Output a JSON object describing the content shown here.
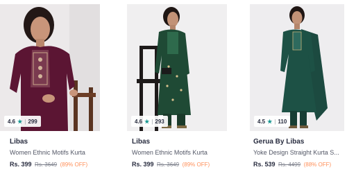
{
  "products": [
    {
      "rating": "4.6",
      "rating_count": "299",
      "brand": "Libas",
      "title": "Women Ethnic Motifs Kurta",
      "price": "Rs. 399",
      "mrp": "Rs. 3649",
      "discount": "(89% OFF)",
      "image_icon": "woman-in-maroon-kurta-image"
    },
    {
      "rating": "4.6",
      "rating_count": "293",
      "brand": "Libas",
      "title": "Women Ethnic Motifs Kurta",
      "price": "Rs. 399",
      "mrp": "Rs. 3649",
      "discount": "(89% OFF)",
      "image_icon": "woman-in-green-kurta-image"
    },
    {
      "rating": "4.5",
      "rating_count": "110",
      "brand": "Gerua By Libas",
      "title": "Yoke Design Straight Kurta S...",
      "price": "Rs. 539",
      "mrp": "Rs. 4499",
      "discount": "(88% OFF)",
      "image_icon": "woman-in-dark-green-kurta-image"
    }
  ],
  "colors": {
    "star": "#14958f",
    "discount": "#ff905a",
    "brand_text": "#282c3f"
  }
}
